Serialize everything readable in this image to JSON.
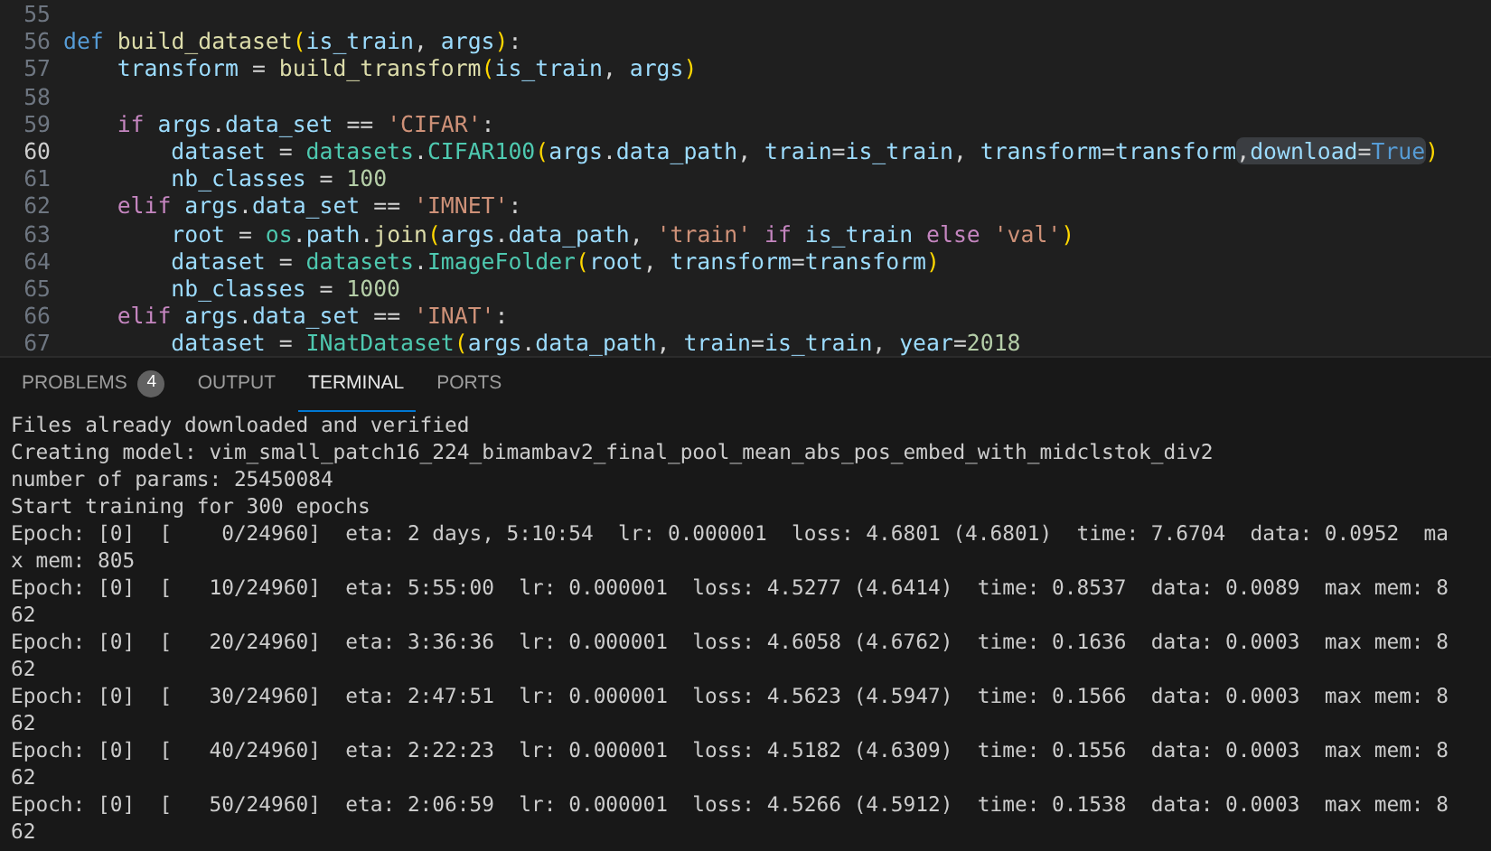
{
  "editor": {
    "lines": [
      {
        "number": "55",
        "current": false
      },
      {
        "number": "56",
        "current": false,
        "tokens": [
          {
            "text": "def",
            "kind": "kw"
          },
          {
            "text": " build_dataset",
            "kind": "fn"
          },
          {
            "text": "(",
            "kind": "br"
          },
          {
            "text": "is_train",
            "kind": "var"
          },
          {
            "text": ", ",
            "kind": "plain"
          },
          {
            "text": "args",
            "kind": "var"
          },
          {
            "text": ")",
            "kind": "br"
          },
          {
            "text": ":",
            "kind": "plain"
          }
        ]
      },
      {
        "number": "57",
        "current": false,
        "tokens": [
          {
            "text": "    transform",
            "kind": "var"
          },
          {
            "text": " = ",
            "kind": "plain"
          },
          {
            "text": "build_transform",
            "kind": "fn"
          },
          {
            "text": "(",
            "kind": "br"
          },
          {
            "text": "is_train",
            "kind": "var"
          },
          {
            "text": ", ",
            "kind": "plain"
          },
          {
            "text": "args",
            "kind": "var"
          },
          {
            "text": ")",
            "kind": "br"
          }
        ]
      },
      {
        "number": "58",
        "current": false
      },
      {
        "number": "59",
        "current": false,
        "tokens": [
          {
            "text": "    if",
            "kind": "ctl"
          },
          {
            "text": " args",
            "kind": "var"
          },
          {
            "text": ".",
            "kind": "plain"
          },
          {
            "text": "data_set",
            "kind": "var"
          },
          {
            "text": " == ",
            "kind": "plain"
          },
          {
            "text": "'CIFAR'",
            "kind": "str"
          },
          {
            "text": ":",
            "kind": "plain"
          }
        ]
      },
      {
        "number": "60",
        "current": true,
        "tokens": [
          {
            "text": "        dataset",
            "kind": "var"
          },
          {
            "text": " = ",
            "kind": "plain"
          },
          {
            "text": "datasets",
            "kind": "cls"
          },
          {
            "text": ".",
            "kind": "plain"
          },
          {
            "text": "CIFAR100",
            "kind": "cls"
          },
          {
            "text": "(",
            "kind": "br"
          },
          {
            "text": "args",
            "kind": "var"
          },
          {
            "text": ".",
            "kind": "plain"
          },
          {
            "text": "data_path",
            "kind": "var"
          },
          {
            "text": ", ",
            "kind": "plain"
          },
          {
            "text": "train",
            "kind": "var"
          },
          {
            "text": "=",
            "kind": "plain"
          },
          {
            "text": "is_train",
            "kind": "var"
          },
          {
            "text": ", ",
            "kind": "plain"
          },
          {
            "text": "transform",
            "kind": "var"
          },
          {
            "text": "=",
            "kind": "plain"
          },
          {
            "text": "transform",
            "kind": "var"
          },
          {
            "kind": "selection",
            "tokens": [
              {
                "text": ",",
                "kind": "plain"
              },
              {
                "text": "download",
                "kind": "var"
              },
              {
                "text": "=",
                "kind": "plain"
              },
              {
                "text": "True",
                "kind": "const"
              }
            ]
          },
          {
            "text": ")",
            "kind": "br"
          }
        ]
      },
      {
        "number": "61",
        "current": false,
        "tokens": [
          {
            "text": "        nb_classes",
            "kind": "var"
          },
          {
            "text": " = ",
            "kind": "plain"
          },
          {
            "text": "100",
            "kind": "num"
          }
        ]
      },
      {
        "number": "62",
        "current": false,
        "tokens": [
          {
            "text": "    elif",
            "kind": "ctl"
          },
          {
            "text": " args",
            "kind": "var"
          },
          {
            "text": ".",
            "kind": "plain"
          },
          {
            "text": "data_set",
            "kind": "var"
          },
          {
            "text": " == ",
            "kind": "plain"
          },
          {
            "text": "'IMNET'",
            "kind": "str"
          },
          {
            "text": ":",
            "kind": "plain"
          }
        ]
      },
      {
        "number": "63",
        "current": false,
        "tokens": [
          {
            "text": "        root",
            "kind": "var"
          },
          {
            "text": " = ",
            "kind": "plain"
          },
          {
            "text": "os",
            "kind": "cls"
          },
          {
            "text": ".",
            "kind": "plain"
          },
          {
            "text": "path",
            "kind": "var"
          },
          {
            "text": ".",
            "kind": "plain"
          },
          {
            "text": "join",
            "kind": "fn"
          },
          {
            "text": "(",
            "kind": "br"
          },
          {
            "text": "args",
            "kind": "var"
          },
          {
            "text": ".",
            "kind": "plain"
          },
          {
            "text": "data_path",
            "kind": "var"
          },
          {
            "text": ", ",
            "kind": "plain"
          },
          {
            "text": "'train'",
            "kind": "str"
          },
          {
            "text": " if",
            "kind": "ctl"
          },
          {
            "text": " is_train",
            "kind": "var"
          },
          {
            "text": " else",
            "kind": "ctl"
          },
          {
            "text": " 'val'",
            "kind": "str"
          },
          {
            "text": ")",
            "kind": "br"
          }
        ]
      },
      {
        "number": "64",
        "current": false,
        "tokens": [
          {
            "text": "        dataset",
            "kind": "var"
          },
          {
            "text": " = ",
            "kind": "plain"
          },
          {
            "text": "datasets",
            "kind": "cls"
          },
          {
            "text": ".",
            "kind": "plain"
          },
          {
            "text": "ImageFolder",
            "kind": "cls"
          },
          {
            "text": "(",
            "kind": "br"
          },
          {
            "text": "root",
            "kind": "var"
          },
          {
            "text": ", ",
            "kind": "plain"
          },
          {
            "text": "transform",
            "kind": "var"
          },
          {
            "text": "=",
            "kind": "plain"
          },
          {
            "text": "transform",
            "kind": "var"
          },
          {
            "text": ")",
            "kind": "br"
          }
        ]
      },
      {
        "number": "65",
        "current": false,
        "tokens": [
          {
            "text": "        nb_classes",
            "kind": "var"
          },
          {
            "text": " = ",
            "kind": "plain"
          },
          {
            "text": "1000",
            "kind": "num"
          }
        ]
      },
      {
        "number": "66",
        "current": false,
        "tokens": [
          {
            "text": "    elif",
            "kind": "ctl"
          },
          {
            "text": " args",
            "kind": "var"
          },
          {
            "text": ".",
            "kind": "plain"
          },
          {
            "text": "data_set",
            "kind": "var"
          },
          {
            "text": " == ",
            "kind": "plain"
          },
          {
            "text": "'INAT'",
            "kind": "str"
          },
          {
            "text": ":",
            "kind": "plain"
          }
        ]
      },
      {
        "number": "67",
        "current": false,
        "tokens": [
          {
            "text": "        dataset",
            "kind": "var"
          },
          {
            "text": " = ",
            "kind": "plain"
          },
          {
            "text": "INatDataset",
            "kind": "cls"
          },
          {
            "text": "(",
            "kind": "br"
          },
          {
            "text": "args",
            "kind": "var"
          },
          {
            "text": ".",
            "kind": "plain"
          },
          {
            "text": "data_path",
            "kind": "var"
          },
          {
            "text": ", ",
            "kind": "plain"
          },
          {
            "text": "train",
            "kind": "var"
          },
          {
            "text": "=",
            "kind": "plain"
          },
          {
            "text": "is_train",
            "kind": "var"
          },
          {
            "text": ", ",
            "kind": "plain"
          },
          {
            "text": "year",
            "kind": "var"
          },
          {
            "text": "=",
            "kind": "plain"
          },
          {
            "text": "2018",
            "kind": "num"
          }
        ]
      }
    ]
  },
  "panel_tabs": [
    {
      "label": "PROBLEMS",
      "badge": "4",
      "selected": false
    },
    {
      "label": "OUTPUT",
      "selected": false
    },
    {
      "label": "TERMINAL",
      "selected": true
    },
    {
      "label": "PORTS",
      "selected": false
    }
  ],
  "terminal": {
    "lines": [
      "Files already downloaded and verified",
      "Creating model: vim_small_patch16_224_bimambav2_final_pool_mean_abs_pos_embed_with_midclstok_div2",
      "number of params: 25450084",
      "Start training for 300 epochs",
      "Epoch: [0]  [    0/24960]  eta: 2 days, 5:10:54  lr: 0.000001  loss: 4.6801 (4.6801)  time: 7.6704  data: 0.0952  ma",
      "x mem: 805",
      "Epoch: [0]  [   10/24960]  eta: 5:55:00  lr: 0.000001  loss: 4.5277 (4.6414)  time: 0.8537  data: 0.0089  max mem: 8",
      "62",
      "Epoch: [0]  [   20/24960]  eta: 3:36:36  lr: 0.000001  loss: 4.6058 (4.6762)  time: 0.1636  data: 0.0003  max mem: 8",
      "62",
      "Epoch: [0]  [   30/24960]  eta: 2:47:51  lr: 0.000001  loss: 4.5623 (4.5947)  time: 0.1566  data: 0.0003  max mem: 8",
      "62",
      "Epoch: [0]  [   40/24960]  eta: 2:22:23  lr: 0.000001  loss: 4.5182 (4.6309)  time: 0.1556  data: 0.0003  max mem: 8",
      "62",
      "Epoch: [0]  [   50/24960]  eta: 2:06:59  lr: 0.000001  loss: 4.5266 (4.5912)  time: 0.1538  data: 0.0003  max mem: 8",
      "62"
    ]
  }
}
